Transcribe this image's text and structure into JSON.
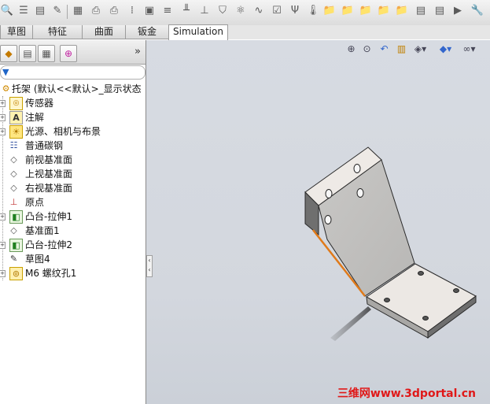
{
  "toolbar": {
    "icons": [
      "zoom-icon",
      "list-icon",
      "doc-stack-icon",
      "edit-doc-icon",
      "grid-icon",
      "print-icon",
      "printer-icon",
      "column-icon",
      "table-icon",
      "bars-icon",
      "ruler-icon",
      "baseline-icon",
      "shield-icon",
      "molecule-icon",
      "curve-icon",
      "checklist-icon",
      "fork-icon",
      "thermometer-icon",
      "folder-icon",
      "folder-edit-icon",
      "folder-view-icon",
      "folder-plus-icon",
      "folder-check-icon",
      "doc-play-icon",
      "play-icon",
      "wrench-icon"
    ]
  },
  "tabs": [
    {
      "label": "草图"
    },
    {
      "label": "特征"
    },
    {
      "label": "曲面"
    },
    {
      "label": "钣金"
    },
    {
      "label": "Simulation"
    }
  ],
  "feature_manager": {
    "more_glyph": "»",
    "filter_glyph": "▼",
    "tree": [
      {
        "label": "托架  (默认<<默认>_显示状态",
        "icon": "part-icon"
      },
      {
        "label": "传感器",
        "icon": "sensor-icon"
      },
      {
        "label": "注解",
        "icon": "annotation-icon"
      },
      {
        "label": "光源、相机与布景",
        "icon": "lights-icon"
      },
      {
        "label": "普通碳钢",
        "icon": "material-icon"
      },
      {
        "label": "前视基准面",
        "icon": "plane-icon"
      },
      {
        "label": "上视基准面",
        "icon": "plane-icon"
      },
      {
        "label": "右视基准面",
        "icon": "plane-icon"
      },
      {
        "label": "原点",
        "icon": "origin-icon"
      },
      {
        "label": "凸台-拉伸1",
        "icon": "extrude-icon"
      },
      {
        "label": "基准面1",
        "icon": "plane-icon"
      },
      {
        "label": "凸台-拉伸2",
        "icon": "extrude-icon"
      },
      {
        "label": "草图4",
        "icon": "sketch-icon"
      },
      {
        "label": "M6 螺纹孔1",
        "icon": "hole-icon"
      }
    ]
  },
  "viewport": {
    "view_toolbar_icons": [
      "zoom-to-fit-icon",
      "zoom-area-icon",
      "previous-view-icon",
      "section-view-icon",
      "view-orientation-icon",
      "display-style-icon",
      "hide-show-icon"
    ],
    "model": "托架"
  },
  "watermark": "三维网www.3dportal.cn"
}
